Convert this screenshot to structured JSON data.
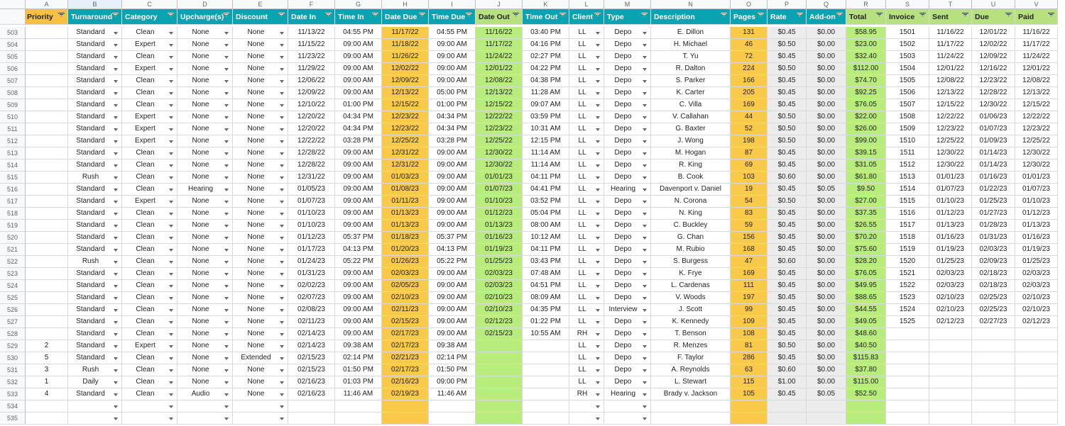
{
  "column_letters": [
    "A",
    "B",
    "C",
    "D",
    "E",
    "F",
    "G",
    "H",
    "I",
    "J",
    "K",
    "L",
    "M",
    "N",
    "O",
    "P",
    "Q",
    "R",
    "S",
    "T",
    "U",
    "V"
  ],
  "header_row_number": "1",
  "headers": [
    "Priority",
    "Turnaround",
    "Category",
    "Upcharge(s)",
    "Discount",
    "Date In",
    "Time In",
    "Date Due",
    "Time Due",
    "Date Out",
    "Time Out",
    "Client",
    "Type",
    "Description",
    "Pages",
    "Rate",
    "Add-on",
    "Total",
    "Invoice",
    "Sent",
    "Due",
    "Paid"
  ],
  "rows": [
    {
      "n": "503",
      "cells": [
        "",
        "Standard",
        "Clean",
        "None",
        "None",
        "11/13/22",
        "04:55 PM",
        "11/17/22",
        "04:55 PM",
        "11/16/22",
        "03:40 PM",
        "LL",
        "Depo",
        "E. Dillon",
        "131",
        "$0.45",
        "$0.00",
        "$58.95",
        "1501",
        "11/16/22",
        "12/01/22",
        "11/16/22"
      ]
    },
    {
      "n": "504",
      "cells": [
        "",
        "Standard",
        "Expert",
        "None",
        "None",
        "11/15/22",
        "09:00 AM",
        "11/18/22",
        "09:00 AM",
        "11/17/22",
        "04:16 PM",
        "LL",
        "Depo",
        "H. Michael",
        "46",
        "$0.50",
        "$0.00",
        "$23.00",
        "1502",
        "11/17/22",
        "12/02/22",
        "11/17/22"
      ]
    },
    {
      "n": "505",
      "cells": [
        "",
        "Standard",
        "Clean",
        "None",
        "None",
        "11/23/22",
        "09:00 AM",
        "11/26/22",
        "09:00 AM",
        "11/24/22",
        "02:27 PM",
        "LL",
        "Depo",
        "T. Yu",
        "72",
        "$0.45",
        "$0.00",
        "$32.40",
        "1503",
        "11/24/22",
        "12/09/22",
        "11/24/22"
      ]
    },
    {
      "n": "506",
      "cells": [
        "",
        "Standard",
        "Expert",
        "None",
        "None",
        "11/29/22",
        "09:00 AM",
        "12/02/22",
        "09:00 AM",
        "12/01/22",
        "04:22 PM",
        "LL",
        "Depo",
        "R. Dalton",
        "224",
        "$0.50",
        "$0.00",
        "$112.00",
        "1504",
        "12/01/22",
        "12/16/22",
        "12/01/22"
      ]
    },
    {
      "n": "507",
      "cells": [
        "",
        "Standard",
        "Clean",
        "None",
        "None",
        "12/06/22",
        "09:00 AM",
        "12/09/22",
        "09:00 AM",
        "12/08/22",
        "04:38 PM",
        "LL",
        "Depo",
        "S. Parker",
        "166",
        "$0.45",
        "$0.00",
        "$74.70",
        "1505",
        "12/08/22",
        "12/23/22",
        "12/08/22"
      ]
    },
    {
      "n": "508",
      "cells": [
        "",
        "Standard",
        "Clean",
        "None",
        "None",
        "12/09/22",
        "09:00 AM",
        "12/13/22",
        "05:00 PM",
        "12/13/22",
        "11:28 AM",
        "LL",
        "Depo",
        "K. Carter",
        "205",
        "$0.45",
        "$0.00",
        "$92.25",
        "1506",
        "12/13/22",
        "12/28/22",
        "12/13/22"
      ]
    },
    {
      "n": "509",
      "cells": [
        "",
        "Standard",
        "Clean",
        "None",
        "None",
        "12/10/22",
        "01:00 PM",
        "12/15/22",
        "01:00 PM",
        "12/15/22",
        "09:07 AM",
        "LL",
        "Depo",
        "C. Villa",
        "169",
        "$0.45",
        "$0.00",
        "$76.05",
        "1507",
        "12/15/22",
        "12/30/22",
        "12/15/22"
      ]
    },
    {
      "n": "510",
      "cells": [
        "",
        "Standard",
        "Expert",
        "None",
        "None",
        "12/20/22",
        "04:34 PM",
        "12/23/22",
        "04:34 PM",
        "12/22/22",
        "03:59 PM",
        "LL",
        "Depo",
        "V. Callahan",
        "44",
        "$0.50",
        "$0.00",
        "$22.00",
        "1508",
        "12/22/22",
        "01/06/23",
        "12/22/22"
      ]
    },
    {
      "n": "511",
      "cells": [
        "",
        "Standard",
        "Expert",
        "None",
        "None",
        "12/20/22",
        "04:34 PM",
        "12/23/22",
        "04:34 PM",
        "12/23/22",
        "10:31 AM",
        "LL",
        "Depo",
        "G. Baxter",
        "52",
        "$0.50",
        "$0.00",
        "$26.00",
        "1509",
        "12/23/22",
        "01/07/23",
        "12/23/22"
      ]
    },
    {
      "n": "512",
      "cells": [
        "",
        "Standard",
        "Expert",
        "None",
        "None",
        "12/22/22",
        "03:28 PM",
        "12/25/22",
        "03:28 PM",
        "12/25/22",
        "12:15 PM",
        "LL",
        "Depo",
        "J. Wong",
        "198",
        "$0.50",
        "$0.00",
        "$99.00",
        "1510",
        "12/25/22",
        "01/09/23",
        "12/25/22"
      ]
    },
    {
      "n": "513",
      "cells": [
        "",
        "Standard",
        "Clean",
        "None",
        "None",
        "12/28/22",
        "09:00 AM",
        "12/31/22",
        "09:00 AM",
        "12/30/22",
        "11:14 AM",
        "LL",
        "Depo",
        "M. Hogan",
        "87",
        "$0.45",
        "$0.00",
        "$39.15",
        "1511",
        "12/30/22",
        "01/14/23",
        "12/30/22"
      ]
    },
    {
      "n": "514",
      "cells": [
        "",
        "Standard",
        "Clean",
        "None",
        "None",
        "12/28/22",
        "09:00 AM",
        "12/31/22",
        "09:00 AM",
        "12/30/22",
        "11:14 AM",
        "LL",
        "Depo",
        "R. King",
        "69",
        "$0.45",
        "$0.00",
        "$31.05",
        "1512",
        "12/30/22",
        "01/14/23",
        "12/30/22"
      ]
    },
    {
      "n": "515",
      "cells": [
        "",
        "Rush",
        "Clean",
        "None",
        "None",
        "12/31/22",
        "09:00 AM",
        "01/03/23",
        "09:00 AM",
        "01/01/23",
        "04:11 PM",
        "LL",
        "Depo",
        "B. Cook",
        "103",
        "$0.60",
        "$0.00",
        "$61.80",
        "1513",
        "01/01/23",
        "01/16/23",
        "01/01/23"
      ]
    },
    {
      "n": "516",
      "cells": [
        "",
        "Standard",
        "Clean",
        "Hearing",
        "None",
        "01/05/23",
        "09:00 AM",
        "01/08/23",
        "09:00 AM",
        "01/07/23",
        "04:41 PM",
        "LL",
        "Hearing",
        "Davenport v. Daniel",
        "19",
        "$0.45",
        "$0.05",
        "$9.50",
        "1514",
        "01/07/23",
        "01/22/23",
        "01/07/23"
      ]
    },
    {
      "n": "517",
      "cells": [
        "",
        "Standard",
        "Expert",
        "None",
        "None",
        "01/07/23",
        "09:00 AM",
        "01/11/23",
        "09:00 AM",
        "01/10/23",
        "03:52 PM",
        "LL",
        "Depo",
        "N. Corona",
        "54",
        "$0.50",
        "$0.00",
        "$27.00",
        "1515",
        "01/10/23",
        "01/25/23",
        "01/10/23"
      ]
    },
    {
      "n": "518",
      "cells": [
        "",
        "Standard",
        "Clean",
        "None",
        "None",
        "01/10/23",
        "09:00 AM",
        "01/13/23",
        "09:00 AM",
        "01/12/23",
        "05:04 PM",
        "LL",
        "Depo",
        "N. King",
        "83",
        "$0.45",
        "$0.00",
        "$37.35",
        "1516",
        "01/12/23",
        "01/27/23",
        "01/12/23"
      ]
    },
    {
      "n": "519",
      "cells": [
        "",
        "Standard",
        "Clean",
        "None",
        "None",
        "01/10/23",
        "09:00 AM",
        "01/13/23",
        "09:00 AM",
        "01/13/23",
        "08:00 AM",
        "LL",
        "Depo",
        "C. Buckley",
        "59",
        "$0.45",
        "$0.00",
        "$26.55",
        "1517",
        "01/13/23",
        "01/28/23",
        "01/13/23"
      ]
    },
    {
      "n": "520",
      "cells": [
        "",
        "Standard",
        "Clean",
        "None",
        "None",
        "01/12/23",
        "05:37 PM",
        "01/18/23",
        "05:37 PM",
        "01/16/23",
        "10:12 AM",
        "LL",
        "Depo",
        "G. Chan",
        "156",
        "$0.45",
        "$0.00",
        "$70.20",
        "1518",
        "01/16/23",
        "01/31/23",
        "01/16/23"
      ]
    },
    {
      "n": "521",
      "cells": [
        "",
        "Standard",
        "Clean",
        "None",
        "None",
        "01/17/23",
        "04:13 PM",
        "01/20/23",
        "04:13 PM",
        "01/19/23",
        "04:11 PM",
        "LL",
        "Depo",
        "M. Rubio",
        "168",
        "$0.45",
        "$0.00",
        "$75.60",
        "1519",
        "01/19/23",
        "02/03/23",
        "01/19/23"
      ]
    },
    {
      "n": "522",
      "cells": [
        "",
        "Rush",
        "Clean",
        "None",
        "None",
        "01/24/23",
        "05:22 PM",
        "01/26/23",
        "05:22 PM",
        "01/25/23",
        "03:43 PM",
        "LL",
        "Depo",
        "S. Burgess",
        "47",
        "$0.60",
        "$0.00",
        "$28.20",
        "1520",
        "01/25/23",
        "02/09/23",
        "01/25/23"
      ]
    },
    {
      "n": "523",
      "cells": [
        "",
        "Standard",
        "Clean",
        "None",
        "None",
        "01/31/23",
        "09:00 AM",
        "02/03/23",
        "09:00 AM",
        "02/03/23",
        "07:48 AM",
        "LL",
        "Depo",
        "K. Frye",
        "169",
        "$0.45",
        "$0.00",
        "$76.05",
        "1521",
        "02/03/23",
        "02/18/23",
        "02/03/23"
      ]
    },
    {
      "n": "524",
      "cells": [
        "",
        "Standard",
        "Clean",
        "None",
        "None",
        "02/02/23",
        "09:00 AM",
        "02/05/23",
        "09:00 AM",
        "02/03/23",
        "04:51 PM",
        "LL",
        "Depo",
        "L. Cardenas",
        "111",
        "$0.45",
        "$0.00",
        "$49.95",
        "1522",
        "02/03/23",
        "02/18/23",
        "02/03/23"
      ]
    },
    {
      "n": "525",
      "cells": [
        "",
        "Standard",
        "Clean",
        "None",
        "None",
        "02/07/23",
        "09:00 AM",
        "02/10/23",
        "09:00 AM",
        "02/10/23",
        "08:09 AM",
        "LL",
        "Depo",
        "V. Woods",
        "197",
        "$0.45",
        "$0.00",
        "$88.65",
        "1523",
        "02/10/23",
        "02/25/23",
        "02/10/23"
      ]
    },
    {
      "n": "526",
      "cells": [
        "",
        "Standard",
        "Clean",
        "None",
        "None",
        "02/08/23",
        "09:00 AM",
        "02/11/23",
        "09:00 AM",
        "02/10/23",
        "04:35 PM",
        "LL",
        "Interview",
        "J. Scott",
        "99",
        "$0.45",
        "$0.00",
        "$44.55",
        "1524",
        "02/10/23",
        "02/25/23",
        "02/10/23"
      ]
    },
    {
      "n": "527",
      "cells": [
        "",
        "Standard",
        "Clean",
        "None",
        "None",
        "02/11/23",
        "09:00 AM",
        "02/15/23",
        "09:00 AM",
        "02/12/23",
        "01:22 PM",
        "LL",
        "Depo",
        "K. Kennedy",
        "109",
        "$0.45",
        "$0.00",
        "$49.05",
        "1525",
        "02/12/23",
        "02/27/23",
        "02/12/23"
      ]
    },
    {
      "n": "528",
      "cells": [
        "",
        "Standard",
        "Clean",
        "None",
        "None",
        "02/14/23",
        "09:00 AM",
        "02/17/23",
        "09:00 AM",
        "02/15/23",
        "10:55 AM",
        "RH",
        "Depo",
        "T. Benson",
        "108",
        "$0.45",
        "$0.00",
        "$48.60",
        "",
        "",
        "",
        ""
      ]
    },
    {
      "n": "529",
      "cells": [
        "2",
        "Standard",
        "Expert",
        "None",
        "None",
        "02/14/23",
        "09:38 AM",
        "02/17/23",
        "09:38 AM",
        "",
        "",
        "LL",
        "Depo",
        "R. Menzes",
        "81",
        "$0.50",
        "$0.00",
        "$40.50",
        "",
        "",
        "",
        ""
      ]
    },
    {
      "n": "530",
      "cells": [
        "5",
        "Standard",
        "Clean",
        "None",
        "Extended",
        "02/15/23",
        "02:14 PM",
        "02/21/23",
        "02:14 PM",
        "",
        "",
        "LL",
        "Depo",
        "F. Taylor",
        "286",
        "$0.45",
        "$0.00",
        "$115.83",
        "",
        "",
        "",
        ""
      ]
    },
    {
      "n": "531",
      "cells": [
        "3",
        "Rush",
        "Clean",
        "None",
        "None",
        "02/15/23",
        "01:50 PM",
        "02/17/23",
        "01:50 PM",
        "",
        "",
        "LL",
        "Depo",
        "A. Reynolds",
        "63",
        "$0.60",
        "$0.00",
        "$37.80",
        "",
        "",
        "",
        ""
      ]
    },
    {
      "n": "532",
      "cells": [
        "1",
        "Daily",
        "Clean",
        "None",
        "None",
        "02/16/23",
        "01:03 PM",
        "02/16/23",
        "09:00 PM",
        "",
        "",
        "LL",
        "Depo",
        "L. Stewart",
        "115",
        "$1.00",
        "$0.00",
        "$115.00",
        "",
        "",
        "",
        ""
      ]
    },
    {
      "n": "533",
      "cells": [
        "4",
        "Standard",
        "Clean",
        "Audio",
        "None",
        "02/16/23",
        "11:46 AM",
        "02/19/23",
        "11:46 AM",
        "",
        "",
        "RH",
        "Hearing",
        "Brady v. Jackson",
        "105",
        "$0.45",
        "$0.05",
        "$52.50",
        "",
        "",
        "",
        ""
      ]
    },
    {
      "n": "534",
      "cells": [
        "",
        "",
        "",
        "",
        "",
        "",
        "",
        "",
        "",
        "",
        "",
        "",
        "",
        "",
        "",
        "",
        "",
        "",
        "",
        "",
        "",
        ""
      ]
    },
    {
      "n": "535",
      "cells": [
        "",
        "",
        "",
        "",
        "",
        "",
        "",
        "",
        "",
        "",
        "",
        "",
        "",
        "",
        "",
        "",
        "",
        "",
        "",
        "",
        "",
        ""
      ]
    }
  ]
}
